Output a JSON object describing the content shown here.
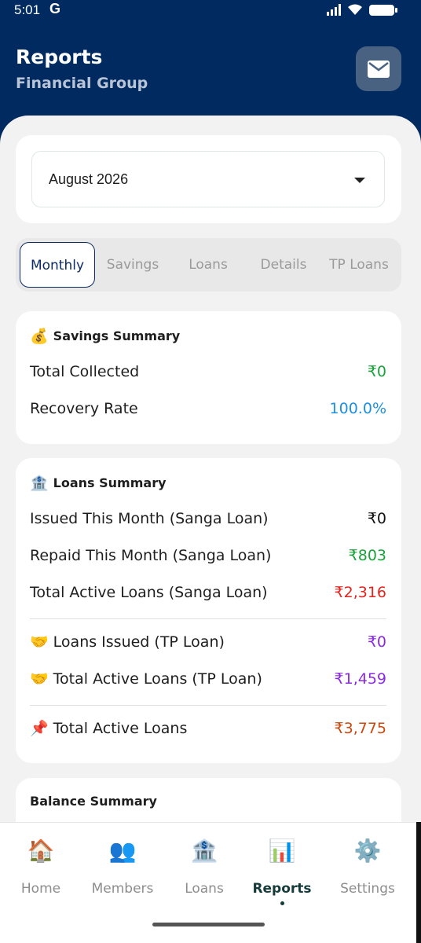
{
  "status_bar": {
    "time": "5:01",
    "g_badge": "G"
  },
  "header": {
    "title": "Reports",
    "subtitle": "Financial Group",
    "mail_icon": "mail-icon"
  },
  "month_select": {
    "value": "August 2026"
  },
  "tabs": [
    {
      "label": "Monthly",
      "active": true
    },
    {
      "label": "Savings"
    },
    {
      "label": "Loans"
    },
    {
      "label": "Details"
    },
    {
      "label": "TP Loans"
    }
  ],
  "savings_summary": {
    "emoji": "💰",
    "title": "Savings Summary",
    "rows": [
      {
        "label": "Total Collected",
        "value": "₹0",
        "color": "#1aa23a"
      },
      {
        "label": "Recovery Rate",
        "value": "100.0%",
        "color": "#1e8fe0"
      }
    ]
  },
  "loans_summary": {
    "emoji": "🏦",
    "title": "Loans Summary",
    "rows": [
      {
        "label": "Issued This Month (Sanga Loan)",
        "value": "₹0",
        "color": "#111111"
      },
      {
        "label": "Repaid This Month (Sanga Loan)",
        "value": "₹803",
        "color": "#1aa23a"
      },
      {
        "label": "Total Active Loans (Sanga Loan)",
        "value": "₹2,316",
        "color": "#e5231e"
      }
    ],
    "tp_rows": [
      {
        "emoji": "🤝",
        "label": "Loans Issued (TP Loan)",
        "value": "₹0",
        "color": "#8a2be2"
      },
      {
        "emoji": "🤝",
        "label": "Total Active Loans (TP Loan)",
        "value": "₹1,459",
        "color": "#8a2be2"
      }
    ],
    "total_row": {
      "emoji": "📌",
      "label": "Total Active Loans",
      "value": "₹3,775",
      "color": "#c9480f"
    }
  },
  "balance_summary": {
    "title": "Balance Summary"
  },
  "bottom_nav": [
    {
      "label": "Home",
      "icon": "🏠"
    },
    {
      "label": "Members",
      "icon": "👥"
    },
    {
      "label": "Loans",
      "icon": "🏦"
    },
    {
      "label": "Reports",
      "icon": "📊",
      "active": true
    },
    {
      "label": "Settings",
      "icon": "⚙️"
    }
  ]
}
